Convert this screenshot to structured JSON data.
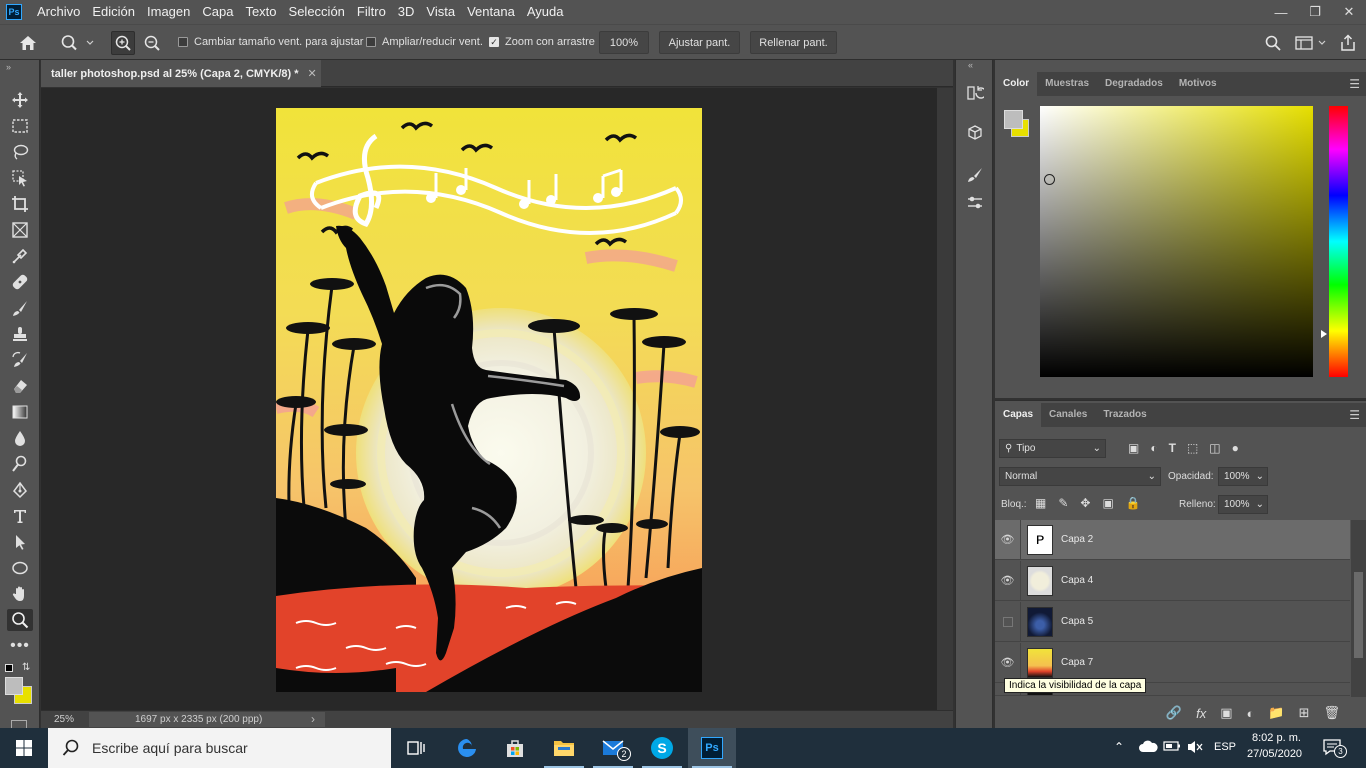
{
  "menubar": {
    "app_logo": "Ps",
    "items": [
      "Archivo",
      "Edición",
      "Imagen",
      "Capa",
      "Texto",
      "Selección",
      "Filtro",
      "3D",
      "Vista",
      "Ventana",
      "Ayuda"
    ],
    "window_controls": [
      "minimize-icon",
      "restore-icon",
      "close-icon"
    ]
  },
  "options": {
    "resize_windows_label": "Cambiar tamaño vent. para ajustar",
    "resize_windows_checked": false,
    "zoom_all_label": "Ampliar/reducir vent.",
    "zoom_all_checked": false,
    "scrubby_zoom_label": "Zoom con arrastre",
    "scrubby_zoom_checked": true,
    "zoom_value": "100%",
    "fit_screen_label": "Ajustar pant.",
    "fill_screen_label": "Rellenar pant."
  },
  "document": {
    "tab_title": "taller photoshop.psd al 25% (Capa 2, CMYK/8) *",
    "status_zoom": "25%",
    "status_info": "1697 px x 2335 px (200 ppp)"
  },
  "color_panel": {
    "tabs": [
      "Color",
      "Muestras",
      "Degradados",
      "Motivos"
    ],
    "active_tab": "Color",
    "foreground_color": "#bdbdbd",
    "background_color": "#e8e000",
    "hue_color": "#e6df00"
  },
  "layers_panel": {
    "tabs": [
      "Capas",
      "Canales",
      "Trazados"
    ],
    "active_tab": "Capas",
    "filter_type": "Tipo",
    "blend_mode": "Normal",
    "opacity_label": "Opacidad:",
    "opacity_value": "100%",
    "lock_label": "Bloq.:",
    "fill_label": "Relleno:",
    "fill_value": "100%",
    "layers": [
      {
        "name": "Capa 2",
        "visible": true,
        "selected": true
      },
      {
        "name": "Capa 4",
        "visible": true,
        "selected": false
      },
      {
        "name": "Capa 5",
        "visible": false,
        "selected": false
      },
      {
        "name": "Capa 7",
        "visible": true,
        "selected": false
      }
    ],
    "tooltip": "Indica la visibilidad de la capa"
  },
  "taskbar": {
    "search_placeholder": "Escribe aquí para buscar",
    "mail_badge": "2",
    "language": "ESP",
    "time": "8:02 p. m.",
    "date": "27/05/2020",
    "notifications": "3"
  }
}
